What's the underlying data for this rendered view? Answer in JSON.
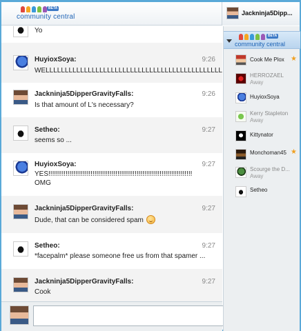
{
  "header": {
    "logo_text": "community central",
    "logo_badge": "BETA",
    "current_user": "Jackninja5Dipp..."
  },
  "colors": {
    "frame": "#5aa9d8",
    "brand": "#1d63b5",
    "star": "#f0a020"
  },
  "messages": [
    {
      "user": "",
      "time": "",
      "text": "Yo",
      "avatar": "setheo-avatar"
    },
    {
      "user": "HuyioxSoya:",
      "time": "9:26",
      "text": "WELLLLLLLLLLLLLLLLLLLLLLLLLLLLLLLLLLLLLLLLLLLLLLLLLLLLLLLLLLL",
      "avatar": "sonic-avatar"
    },
    {
      "user": "Jackninja5DipperGravityFalls:",
      "time": "9:26",
      "text": "Is that amount of L's necessary?",
      "avatar": "dipper-avatar"
    },
    {
      "user": "Setheo:",
      "time": "9:27",
      "text": "seems so ...",
      "avatar": "setheo-avatar"
    },
    {
      "user": "HuyioxSoya:",
      "time": "9:27",
      "text": "YES!!!!!!!!!!!!!!!!!!!!!!!!!!!!!!!!!!!!!!!!!!!!!!!!!!!!!!!!!!!!!!!!!!!!!!!!!!!",
      "text2": "OMG",
      "avatar": "sonic-avatar"
    },
    {
      "user": "Jackninja5DipperGravityFalls:",
      "time": "9:27",
      "text": "Dude, that can be considered spam",
      "avatar": "dipper-avatar",
      "emoji": "smiley-icon"
    },
    {
      "user": "Setheo:",
      "time": "9:27",
      "text": "*facepalm* please someone free us from that spamer ...",
      "avatar": "setheo-avatar"
    },
    {
      "user": "Jackninja5DipperGravityFalls:",
      "time": "9:27",
      "text": "Cook",
      "avatar": "dipper-avatar"
    }
  ],
  "input": {
    "placeholder": "",
    "value": ""
  },
  "sidebar": {
    "room_label": "community central",
    "room_badge": "BETA",
    "users": [
      {
        "name": "Cook Me Plox",
        "status": "",
        "star": "★",
        "avatar": "cook-avatar"
      },
      {
        "name": "HERROZAEL",
        "status": "Away",
        "star": "",
        "avatar": "herrozael-avatar"
      },
      {
        "name": "HuyioxSoya",
        "status": "",
        "star": "",
        "avatar": "sonic-avatar"
      },
      {
        "name": "Kerry Stapleton",
        "status": "Away",
        "star": "",
        "avatar": "kerry-avatar"
      },
      {
        "name": "Kittynator",
        "status": "",
        "star": "",
        "avatar": "kitty-avatar"
      },
      {
        "name": "Monchoman45",
        "status": "",
        "star": "★",
        "avatar": "monch-avatar"
      },
      {
        "name": "Scourge the D...",
        "status": "Away",
        "star": "",
        "avatar": "scourge-avatar"
      },
      {
        "name": "Setheo",
        "status": "",
        "star": "",
        "avatar": "setheo-avatar"
      }
    ]
  }
}
